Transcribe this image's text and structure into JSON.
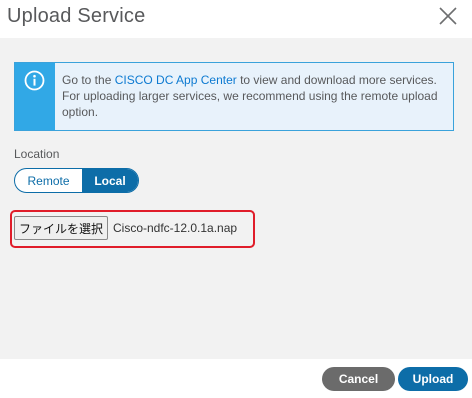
{
  "dialog": {
    "title": "Upload Service",
    "close_icon": "close-icon"
  },
  "info": {
    "icon": "info-icon",
    "text_before_link": "Go to the ",
    "link_text": "CISCO DC App Center",
    "text_after_link": " to view and download more services. For uploading larger services, we recommend using the remote upload option."
  },
  "location": {
    "label": "Location",
    "options": [
      "Remote",
      "Local"
    ],
    "selected": "Local"
  },
  "file": {
    "button_label": "ファイルを選択",
    "file_name": "Cisco-ndfc-12.0.1a.nap"
  },
  "footer": {
    "cancel_label": "Cancel",
    "upload_label": "Upload"
  },
  "colors": {
    "primary": "#0d6da8",
    "info_accent": "#31a8e6",
    "highlight": "#e01d2a",
    "cancel": "#6b6b6b"
  }
}
